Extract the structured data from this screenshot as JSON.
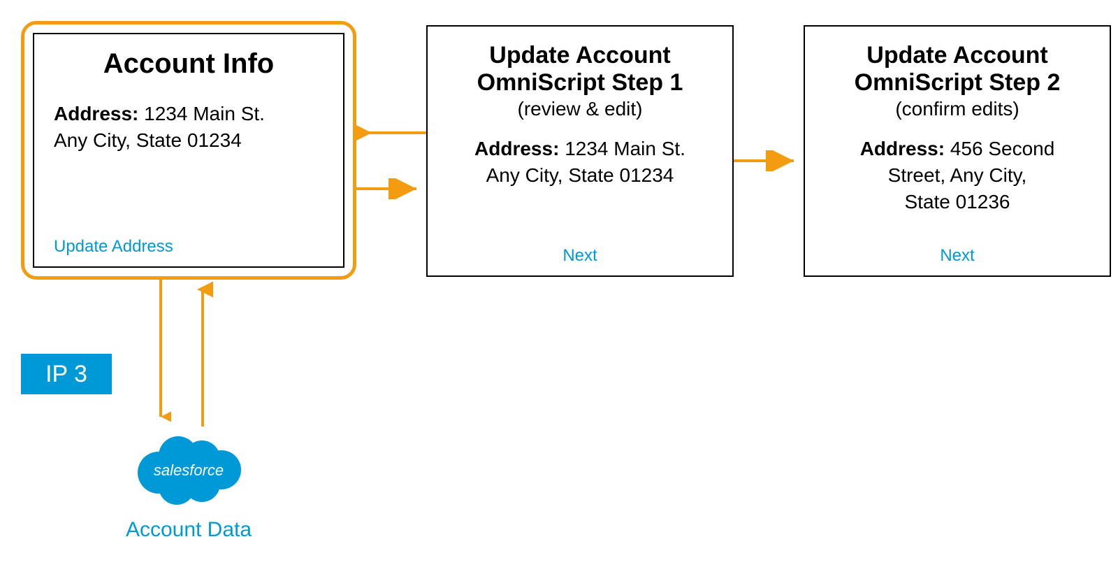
{
  "colors": {
    "accent_orange": "#F39C12",
    "link_blue": "#0099D8"
  },
  "card1": {
    "title": "Account  Info",
    "address_label": "Address:",
    "address_line1": "1234 Main St.",
    "address_line2": "Any City, State 01234",
    "link": "Update Address"
  },
  "card2": {
    "title_line1": "Update Account",
    "title_line2": "OmniScript Step 1",
    "subtitle": "(review & edit)",
    "address_label": "Address:",
    "address_line1": "1234 Main St.",
    "address_line2": "Any City, State 01234",
    "next": "Next"
  },
  "card3": {
    "title_line1": "Update Account",
    "title_line2": "OmniScript Step 2",
    "subtitle": "(confirm edits)",
    "address_label": "Address:",
    "address_rest1": "456 Second",
    "address_line2": "Street, Any City,",
    "address_line3": "State 01236",
    "next": "Next"
  },
  "badge": {
    "label": "IP 3"
  },
  "cloud": {
    "brand": "salesforce",
    "label": "Account Data"
  }
}
